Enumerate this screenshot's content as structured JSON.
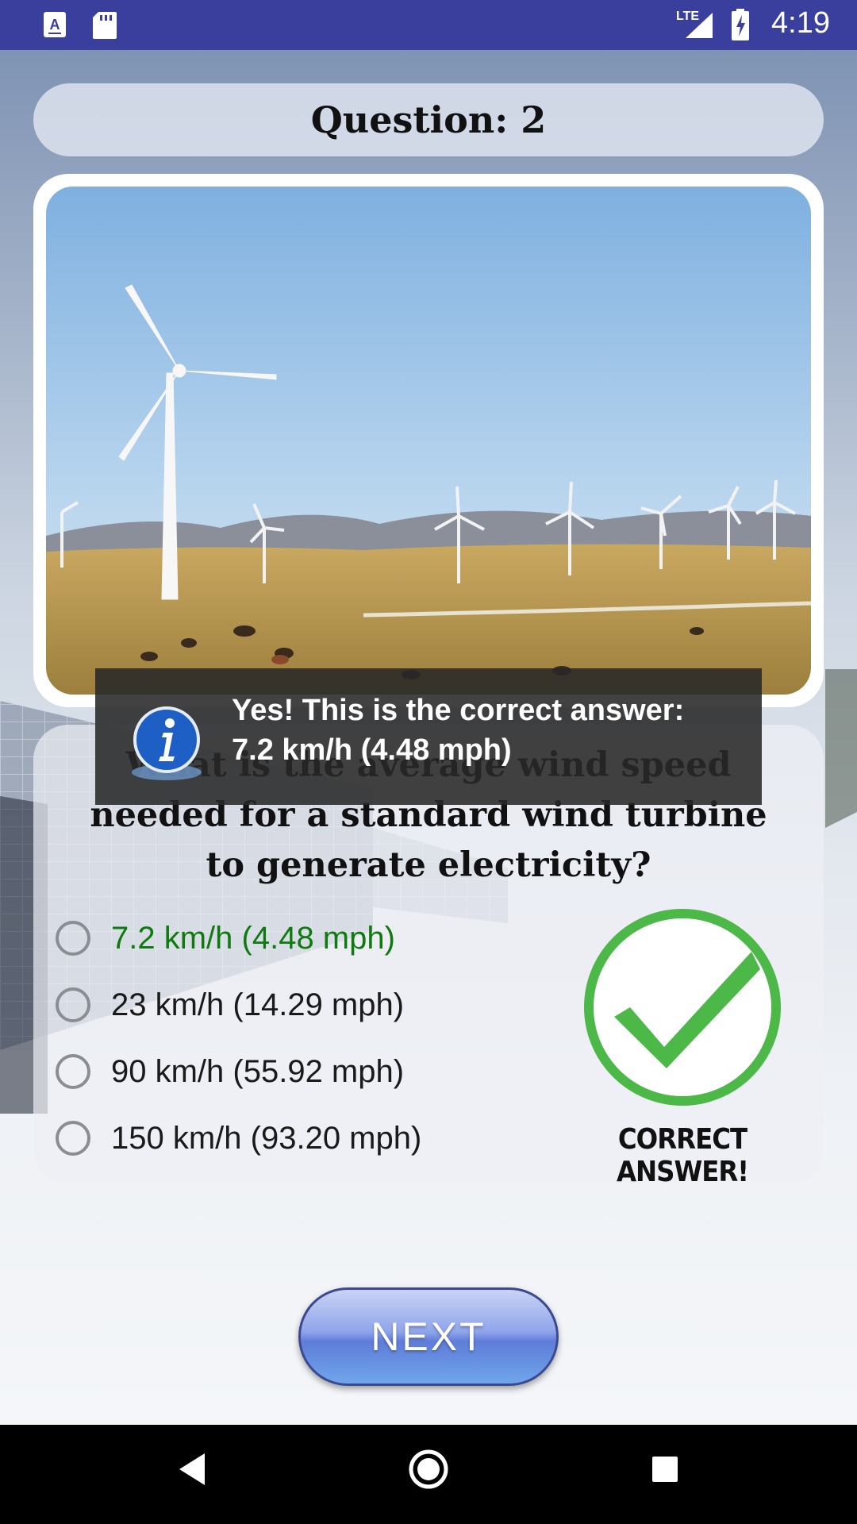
{
  "status_bar": {
    "time": "4:19",
    "icons": [
      "keyboard-a-icon",
      "sd-card-icon",
      "lte-signal-icon",
      "battery-charging-icon"
    ],
    "network_label": "LTE"
  },
  "quiz": {
    "header": "Question: 2",
    "image": "wind-farm-photo",
    "question": "What is the average wind speed needed for a standard wind turbine to generate electricity?",
    "options": [
      {
        "label": "7.2 km/h (4.48 mph)",
        "correct": true
      },
      {
        "label": "23 km/h (14.29 mph)",
        "correct": false
      },
      {
        "label": "90 km/h (55.92 mph)",
        "correct": false
      },
      {
        "label": "150 km/h (93.20 mph)",
        "correct": false
      }
    ],
    "feedback": {
      "text": "CORRECT ANSWER!",
      "icon": "checkmark-circle-icon",
      "color": "#4cb848"
    },
    "next_label": "NEXT"
  },
  "toast": {
    "line1": "Yes! This is the correct answer:",
    "line2": "7.2 km/h (4.48 mph)",
    "icon": "info-icon"
  },
  "colors": {
    "status_bar": "#3a3f9e",
    "correct_text": "#0f7a0f",
    "check_green": "#4cb848"
  },
  "nav_bar": {
    "buttons": [
      "back-icon",
      "home-icon",
      "recents-icon"
    ]
  }
}
